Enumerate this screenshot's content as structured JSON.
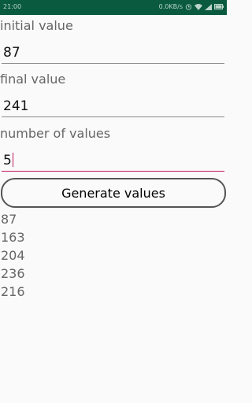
{
  "status_bar": {
    "time": "21:00",
    "speed": "0.0KB/s",
    "icons": [
      "alarm-icon",
      "wifi-icon",
      "signal-icon",
      "battery-icon"
    ],
    "background": "#0a5a3f"
  },
  "form": {
    "initial": {
      "label": "initial value",
      "value": "87"
    },
    "final": {
      "label": "final value",
      "value": "241"
    },
    "count": {
      "label": "number of values",
      "value": "5"
    }
  },
  "button": {
    "label": "Generate values"
  },
  "results": [
    "87",
    "163",
    "204",
    "236",
    "216"
  ],
  "colors": {
    "accent": "#c2185b",
    "label_text": "#666666",
    "underline": "#8a8a8a"
  }
}
